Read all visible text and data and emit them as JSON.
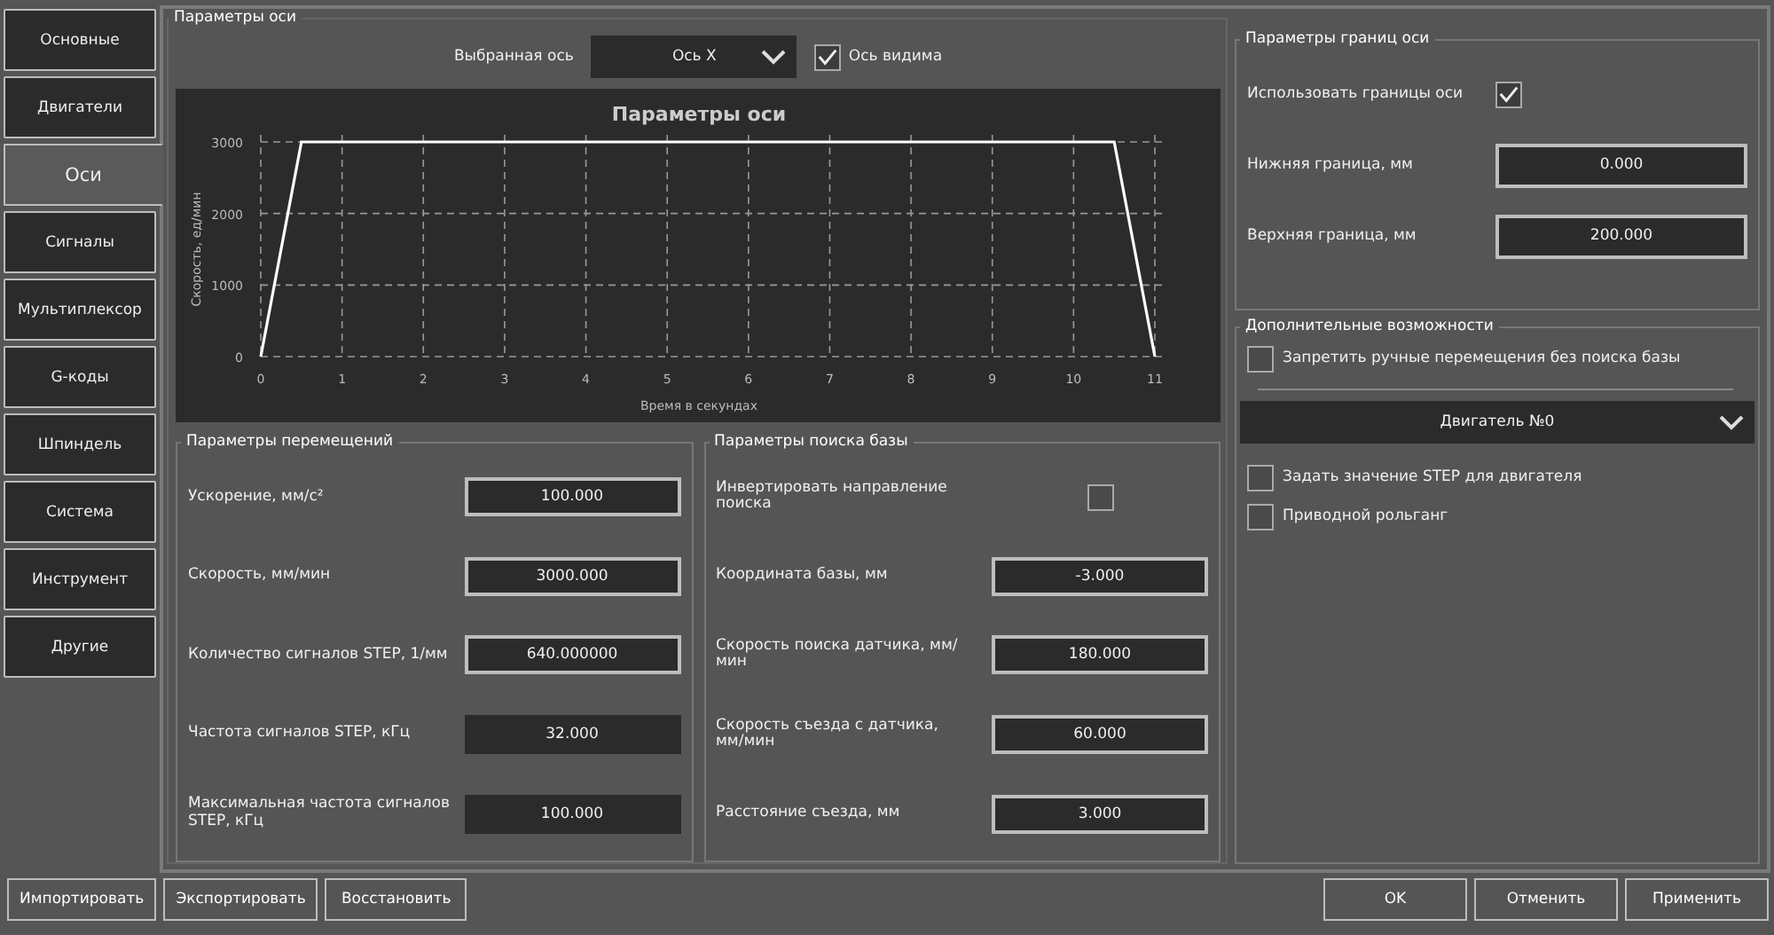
{
  "nav": [
    {
      "label": "Основные",
      "selected": false
    },
    {
      "label": "Двигатели",
      "selected": false
    },
    {
      "label": "Оси",
      "selected": true
    },
    {
      "label": "Сигналы",
      "selected": false
    },
    {
      "label": "Мультиплексор",
      "selected": false
    },
    {
      "label": "G-коды",
      "selected": false
    },
    {
      "label": "Шпиндель",
      "selected": false
    },
    {
      "label": "Система",
      "selected": false
    },
    {
      "label": "Инструмент",
      "selected": false
    },
    {
      "label": "Другие",
      "selected": false
    }
  ],
  "axis_params": {
    "title": "Параметры оси",
    "selected_axis_label": "Выбранная ось",
    "selected_axis": "Ось X",
    "axis_visible": {
      "label": "Ось видима",
      "checked": true
    },
    "chart_data": {
      "type": "line",
      "title": "Параметры оси",
      "xlabel": "Время в секундах",
      "ylabel": "Скорость, ед/мин",
      "xlim": [
        0,
        11
      ],
      "ylim": [
        0,
        3000
      ],
      "xticks": [
        0,
        1,
        2,
        3,
        4,
        5,
        6,
        7,
        8,
        9,
        10,
        11
      ],
      "yticks": [
        0,
        1000,
        2000,
        3000
      ],
      "x": [
        0,
        0.5,
        10.5,
        11
      ],
      "grid": true,
      "series": [
        {
          "color": "#ffffff",
          "values": [
            0,
            3000,
            3000,
            0
          ]
        }
      ]
    },
    "motion": {
      "title": "Параметры перемещений",
      "fields": [
        {
          "label": "Ускорение, мм/с²",
          "value": "100.000",
          "readonly": false
        },
        {
          "label": "Скорость, мм/мин",
          "value": "3000.000",
          "readonly": false
        },
        {
          "label": "Количество сигналов STEP, 1/мм",
          "value": "640.000000",
          "readonly": false
        },
        {
          "label": "Частота сигналов STEP, кГц",
          "value": "32.000",
          "readonly": true
        },
        {
          "label": "Максимальная частота сигналов STEP, кГц",
          "value": "100.000",
          "readonly": true
        }
      ]
    },
    "homing": {
      "title": "Параметры поиска базы",
      "rows": [
        {
          "kind": "checkbox",
          "label": "Инвертировать направление поиска",
          "checked": false
        },
        {
          "kind": "field",
          "label": "Координата базы, мм",
          "value": "-3.000",
          "readonly": false
        },
        {
          "kind": "field",
          "label": "Скорость поиска датчика, мм/мин",
          "value": "180.000",
          "readonly": false
        },
        {
          "kind": "field",
          "label": "Скорость съезда с датчика, мм/мин",
          "value": "60.000",
          "readonly": false
        },
        {
          "kind": "field",
          "label": "Расстояние съезда, мм",
          "value": "3.000",
          "readonly": false
        }
      ]
    }
  },
  "limits": {
    "title": "Параметры границ оси",
    "rows": [
      {
        "kind": "checkbox",
        "label": "Использовать границы оси",
        "checked": true
      },
      {
        "kind": "field",
        "label": "Нижняя граница, мм",
        "value": "0.000",
        "readonly": false
      },
      {
        "kind": "field",
        "label": "Верхняя граница, мм",
        "value": "200.000",
        "readonly": false
      }
    ]
  },
  "extras": {
    "title": "Дополнительные возможности",
    "forbid": {
      "label": "Запретить ручные перемещения без поиска базы",
      "checked": false
    },
    "motor": "Двигатель №0",
    "options": [
      {
        "label": "Задать значение STEP для двигателя",
        "checked": false
      },
      {
        "label": "Приводной рольганг",
        "checked": false
      }
    ]
  },
  "buttons_left": [
    "Импортировать",
    "Экспортировать",
    "Восстановить"
  ],
  "buttons_right": [
    "OK",
    "Отменить",
    "Применить"
  ]
}
